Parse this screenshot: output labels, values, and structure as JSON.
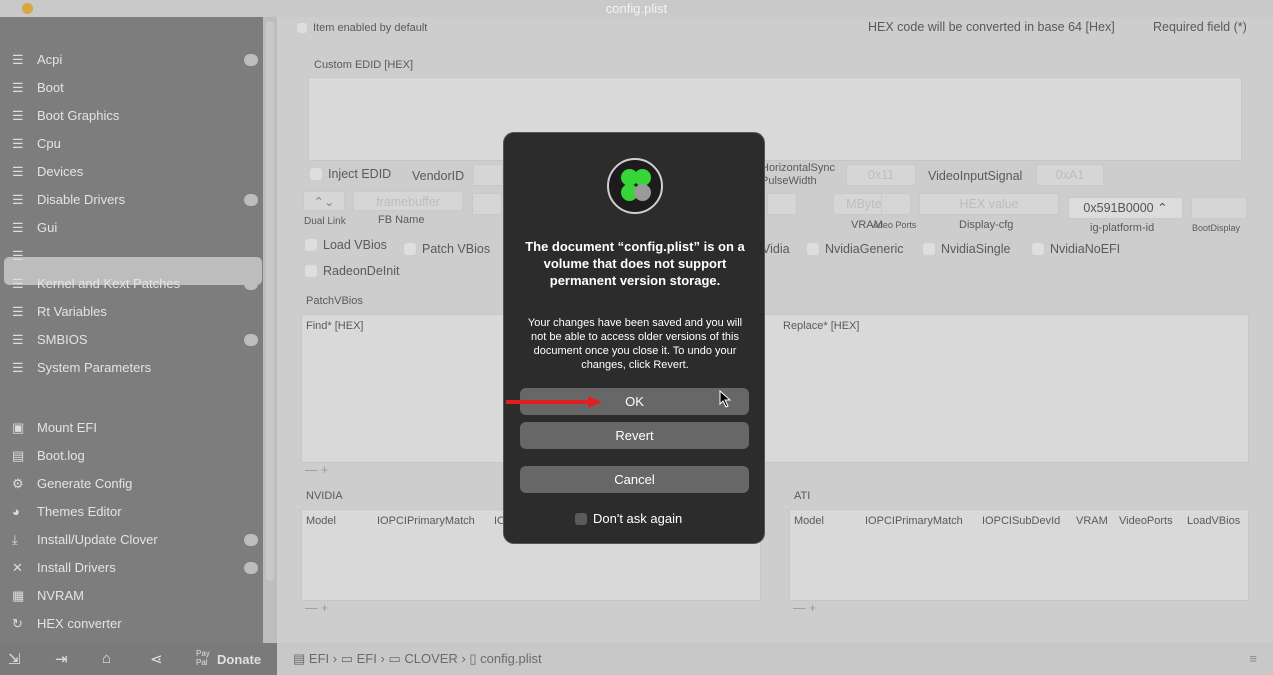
{
  "window": {
    "title": "config.plist"
  },
  "sidebar": {
    "items": [
      {
        "label": "Acpi",
        "icon": "list-icon",
        "badge": true
      },
      {
        "label": "Boot",
        "icon": "list-icon"
      },
      {
        "label": "Boot Graphics",
        "icon": "list-icon"
      },
      {
        "label": "Cpu",
        "icon": "list-icon"
      },
      {
        "label": "Devices",
        "icon": "list-icon"
      },
      {
        "label": "Disable Drivers",
        "icon": "list-icon",
        "badge": true
      },
      {
        "label": "Gui",
        "icon": "list-icon"
      },
      {
        "label": "",
        "icon": "list-icon",
        "selected": true
      },
      {
        "label": "Kernel and Kext Patches",
        "icon": "list-icon",
        "badge": true
      },
      {
        "label": "Rt Variables",
        "icon": "list-icon"
      },
      {
        "label": "SMBIOS",
        "icon": "list-icon",
        "badge": true
      },
      {
        "label": "System Parameters",
        "icon": "list-icon"
      }
    ],
    "tools": [
      {
        "label": "Mount EFI",
        "icon": "disk-icon"
      },
      {
        "label": "Boot.log",
        "icon": "log-icon"
      },
      {
        "label": "Generate Config",
        "icon": "gear-icon"
      },
      {
        "label": "Themes Editor",
        "icon": "palette-icon"
      },
      {
        "label": "Install/Update Clover",
        "icon": "download-icon",
        "badge": true
      },
      {
        "label": "Install Drivers",
        "icon": "tools-icon",
        "badge": true
      },
      {
        "label": "NVRAM",
        "icon": "chip-icon"
      },
      {
        "label": "HEX converter",
        "icon": "refresh-icon"
      }
    ],
    "bottom": {
      "donate": "Donate",
      "paypal": "Pay Pal"
    }
  },
  "main": {
    "item_enabled": "Item enabled by default",
    "hex_note": "HEX code will be converted in base 64 [Hex]",
    "required": "Required field (*)",
    "custom_edid": "Custom EDID [HEX]",
    "inject_edid": "Inject EDID",
    "vendor_id": "VendorID",
    "hsync": "HorizontalSync PulseWidth",
    "hsync_value": "0x11",
    "video_input": "VideoInputSignal",
    "video_input_value": "0xA1",
    "dual_link": "Dual Link",
    "fb_name": "FB Name",
    "fb_placeholder": "framebuffer",
    "vram": "VRAM",
    "vram_placeholder": "MBytes",
    "video_ports": "Video Ports",
    "display_cfg": "Display-cfg",
    "display_cfg_placeholder": "HEX value",
    "ig_platform": "ig-platform-id",
    "ig_platform_value": "0x591B0000",
    "boot_display": "BootDisplay",
    "checks": [
      "Load VBios",
      "Patch VBios",
      "Vidia",
      "NvidiaGeneric",
      "NvidiaSingle",
      "NvidiaNoEFI",
      "RadeonDeInit"
    ],
    "patch_vbios": "PatchVBios",
    "find": "Find* [HEX]",
    "replace": "Replace* [HEX]",
    "nvidia": "NVIDIA",
    "ati": "ATI",
    "nvidia_cols": [
      "Model",
      "IOPCIPrimaryMatch",
      "IO"
    ],
    "ati_cols": [
      "Model",
      "IOPCIPrimaryMatch",
      "IOPCISubDevId",
      "VRAM",
      "VideoPorts",
      "LoadVBios"
    ],
    "plusminus": "— +"
  },
  "pathbar": [
    "EFI",
    "EFI",
    "CLOVER",
    "config.plist"
  ],
  "dialog": {
    "title": "The document “config.plist” is on a volume that does not support permanent version storage.",
    "message": "Your changes have been saved and you will not be able to access older versions of this document once you close it. To undo your changes, click Revert.",
    "ok": "OK",
    "revert": "Revert",
    "cancel": "Cancel",
    "dont_ask": "Don't ask again"
  },
  "colors": {
    "accent_arrow": "#e02020",
    "logo_green": "#37d637"
  }
}
